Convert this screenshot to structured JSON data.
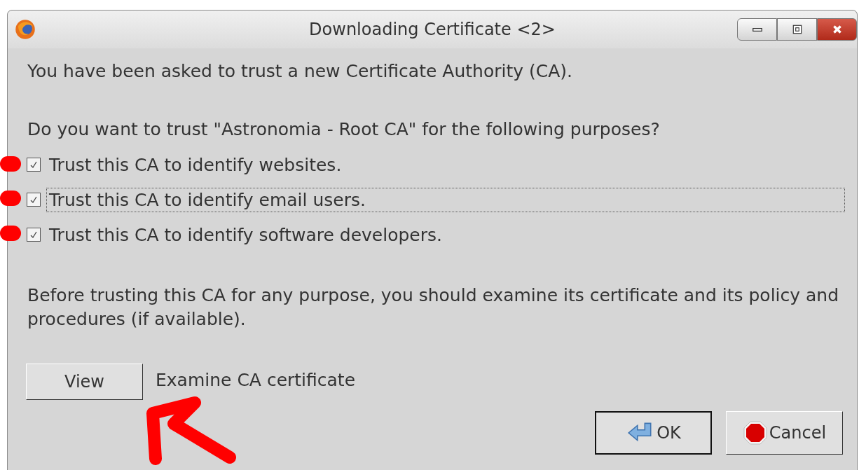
{
  "window": {
    "title": "Downloading Certificate <2>"
  },
  "intro": "You have been asked to trust a new Certificate Authority (CA).",
  "question": "Do you want to trust \"Astronomia - Root CA\" for the following purposes?",
  "purposes": [
    {
      "label": "Trust this CA to identify websites.",
      "checked": true,
      "focused": false
    },
    {
      "label": "Trust this CA to identify email users.",
      "checked": true,
      "focused": true
    },
    {
      "label": "Trust this CA to identify software developers.",
      "checked": true,
      "focused": false
    }
  ],
  "advice": "Before trusting this CA for any purpose, you should examine its certificate and its policy and procedures (if available).",
  "view": {
    "button": "View",
    "description": "Examine CA certificate"
  },
  "buttons": [
    {
      "kind": "ok",
      "label": "OK"
    },
    {
      "kind": "cancel",
      "label": "Cancel"
    }
  ]
}
